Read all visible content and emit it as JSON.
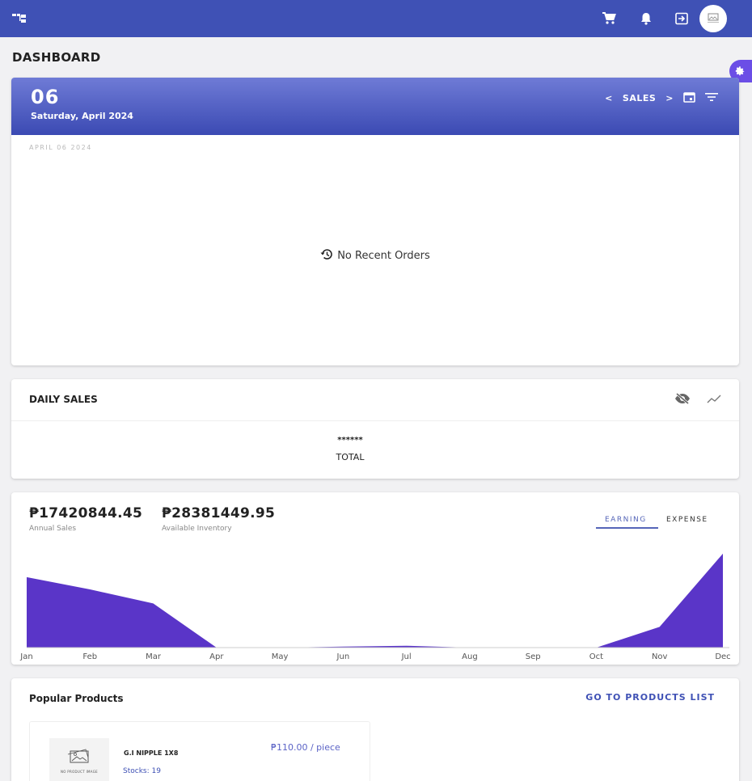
{
  "header": {
    "logo_icon": "sitemap-icon",
    "cart_icon": "cart-icon",
    "bell_icon": "bell-icon",
    "logout_icon": "logout-icon",
    "avatar_icon": "no-image-avatar"
  },
  "page": {
    "title": "DASHBOARD"
  },
  "settings_fab": {
    "icon": "gear-icon"
  },
  "calendar_card": {
    "day": "06",
    "date_label": "Saturday, April 2024",
    "nav_prev": "<",
    "nav_label": "SALES",
    "nav_next": ">",
    "calendar_icon": "calendar-icon",
    "filter_icon": "filter-icon",
    "sub_date": "APRIL 06 2024",
    "empty_text": "No Recent Orders",
    "empty_icon": "history-icon"
  },
  "daily_sales": {
    "title": "DAILY SALES",
    "hide_icon": "eye-off-icon",
    "trend_icon": "trend-icon",
    "value": "******",
    "total_label": "TOTAL"
  },
  "summary": {
    "annual_sales": "₱17420844.45",
    "annual_sales_label": "Annual Sales",
    "inventory": "₱28381449.95",
    "inventory_label": "Available Inventory",
    "tab_earning": "EARNING",
    "tab_expense": "EXPENSE"
  },
  "chart_data": {
    "type": "area",
    "categories": [
      "Jan",
      "Feb",
      "Mar",
      "Apr",
      "May",
      "Jun",
      "Jul",
      "Aug",
      "Sep",
      "Oct",
      "Nov",
      "Dec"
    ],
    "values": [
      0.75,
      0.62,
      0.47,
      0.0,
      0.0,
      0.01,
      0.02,
      0.0,
      0.0,
      0.0,
      0.22,
      1.0
    ],
    "color": "#5a35c8",
    "grid": false,
    "ylim": [
      0,
      1.05
    ]
  },
  "popular_products": {
    "title": "Popular Products",
    "link": "GO TO PRODUCTS LIST",
    "items": [
      {
        "image_text": "NO PRODUCT IMAGE",
        "name": "G.I NIPPLE 1X8",
        "stock": "Stocks: 19",
        "price": "₱110.00 / piece"
      }
    ]
  }
}
